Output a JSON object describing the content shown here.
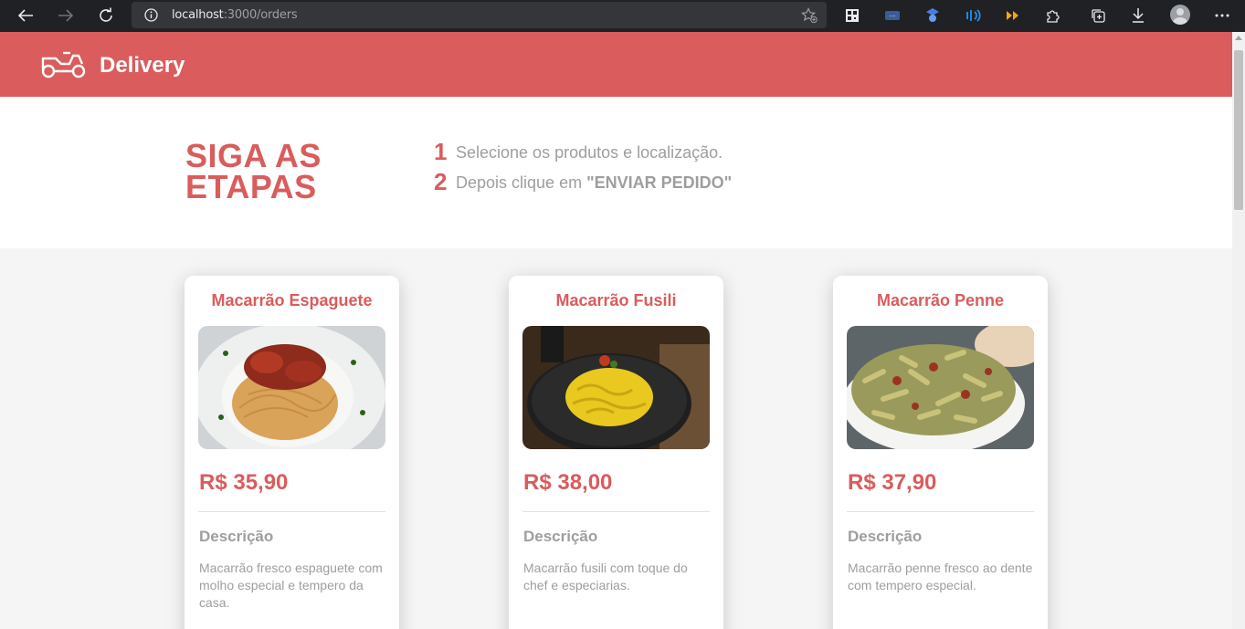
{
  "browser": {
    "url_host": "localhost",
    "url_path": ":3000/orders",
    "icons": [
      "back-icon",
      "forward-icon",
      "reload-icon",
      "info-icon",
      "favorite-icon",
      "qr-icon",
      "extension-icon",
      "puzzle-icon",
      "collections-icon",
      "download-icon",
      "profile-icon",
      "more-icon"
    ]
  },
  "header": {
    "brand": "Delivery",
    "color": "#da5c5c"
  },
  "steps": {
    "title": "SIGA AS ETAPAS",
    "items": [
      {
        "num": "1",
        "text": "Selecione os produtos e localização.",
        "strong": ""
      },
      {
        "num": "2",
        "text": "Depois clique em ",
        "strong": "\"ENVIAR PEDIDO\""
      }
    ]
  },
  "products": [
    {
      "name": "Macarrão Espaguete",
      "price": "R$ 35,90",
      "desc_label": "Descrição",
      "description": "Macarrão fresco espaguete com molho especial e tempero da casa."
    },
    {
      "name": "Macarrão Fusili",
      "price": "R$ 38,00",
      "desc_label": "Descrição",
      "description": "Macarrão fusili com toque do chef e especiarias."
    },
    {
      "name": "Macarrão Penne",
      "price": "R$ 37,90",
      "desc_label": "Descrição",
      "description": "Macarrão penne fresco ao dente com tempero especial."
    }
  ]
}
